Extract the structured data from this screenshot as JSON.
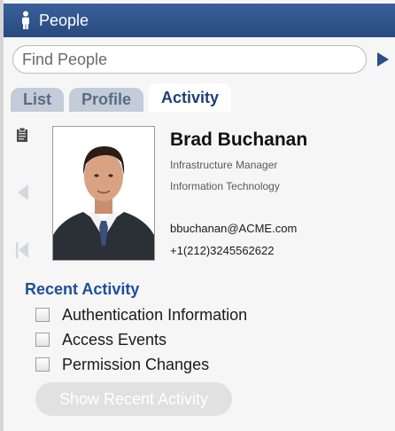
{
  "window": {
    "title": "People",
    "icon": "person-icon"
  },
  "search": {
    "placeholder": "Find People",
    "value": "",
    "go_icon": "play-arrow-icon"
  },
  "tabs": [
    {
      "label": "List",
      "active": false
    },
    {
      "label": "Profile",
      "active": false
    },
    {
      "label": "Activity",
      "active": true
    }
  ],
  "sidebar_icons": [
    "clipboard-icon",
    "previous-arrow-icon",
    "first-record-icon"
  ],
  "profile": {
    "name": "Brad Buchanan",
    "title": "Infrastructure Manager",
    "department": "Information Technology",
    "email": "bbuchanan@ACME.com",
    "phone": "+1(212)3245562622"
  },
  "recent_activity": {
    "heading": "Recent Activity",
    "options": [
      {
        "label": "Authentication Information",
        "checked": false
      },
      {
        "label": "Access Events",
        "checked": false
      },
      {
        "label": "Permission Changes",
        "checked": false
      }
    ],
    "button_label": "Show Recent Activity",
    "button_enabled": false
  },
  "colors": {
    "titlebar": "#284a80",
    "accent": "#1f4e9a",
    "tab_inactive": "#c3ccd8",
    "disabled_button": "#e1e1e1"
  }
}
